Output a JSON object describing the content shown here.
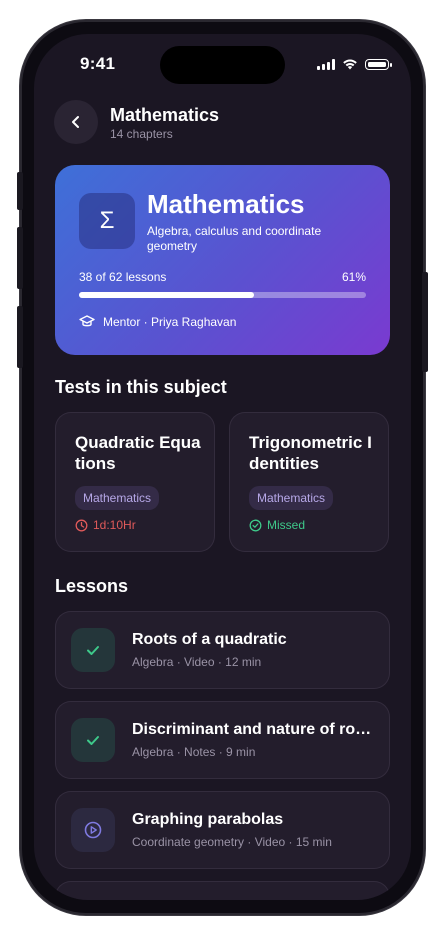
{
  "status_bar": {
    "time": "9:41"
  },
  "header": {
    "title": "Mathematics",
    "subtitle": "14 chapters"
  },
  "hero": {
    "icon_symbol": "Σ",
    "title": "Mathematics",
    "description": "Algebra, calculus and coordinate geometry",
    "progress_label": "38 of 62 lessons",
    "progress_percent_text": "61%",
    "progress_fraction": 0.61,
    "mentor": "Mentor · Priya Raghavan"
  },
  "tests_section": {
    "title": "Tests in this subject",
    "tests": [
      {
        "name": "Quadratic Equations",
        "subject": "Mathematics",
        "status": "1d:10Hr",
        "status_color": "#e05a5a",
        "status_icon": "clock-icon"
      },
      {
        "name": "Trigonometric Identities",
        "subject": "Mathematics",
        "status": "Missed",
        "status_color": "#3ec98a",
        "status_icon": "check-circle-icon"
      }
    ]
  },
  "lessons_section": {
    "title": "Lessons",
    "lessons": [
      {
        "title": "Roots of a quadratic",
        "meta": "Algebra · Video · 12 min",
        "state": "completed",
        "icon": "check-icon"
      },
      {
        "title": "Discriminant and nature of roots",
        "meta": "Algebra · Notes · 9 min",
        "state": "completed",
        "icon": "check-icon"
      },
      {
        "title": "Graphing parabolas",
        "meta": "Coordinate geometry · Video · 15 min",
        "state": "pending",
        "icon": "play-circle-icon"
      }
    ]
  },
  "colors": {
    "background": "#1b1623",
    "card": "#231d2c",
    "accent_purple": "#7a3ad0",
    "accent_blue": "#3e70d8",
    "success": "#3ec98a",
    "danger": "#e05a5a"
  }
}
